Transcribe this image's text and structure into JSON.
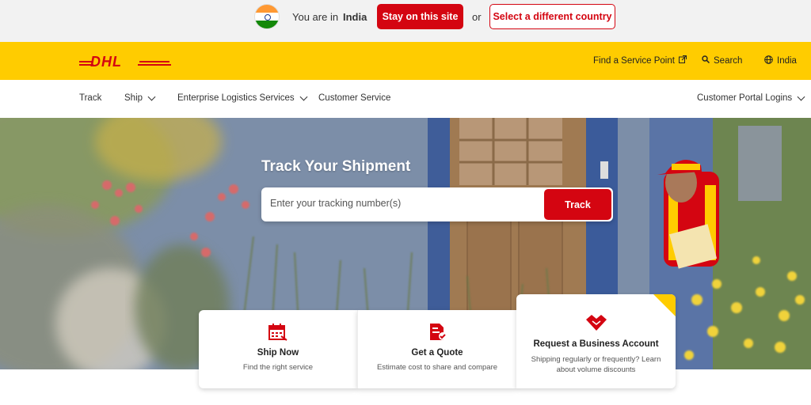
{
  "country_bar": {
    "you_are_in": "You are in",
    "country": "India",
    "stay_button": "Stay on this site",
    "or": "or",
    "different_country_button": "Select a different country"
  },
  "header": {
    "logo_text": "DHL",
    "service_point": "Find a Service Point",
    "search": "Search",
    "region": "India"
  },
  "nav": {
    "items": [
      {
        "label": "Track"
      },
      {
        "label": "Ship"
      },
      {
        "label": "Enterprise Logistics Services"
      },
      {
        "label": "Customer Service"
      }
    ],
    "portal": "Customer Portal Logins"
  },
  "hero": {
    "title": "Track Your Shipment",
    "input_placeholder": "Enter your tracking number(s)",
    "track_button": "Track"
  },
  "cards": [
    {
      "title": "Ship Now",
      "subtitle": "Find the right service",
      "icon": "calendar-icon"
    },
    {
      "title": "Get a Quote",
      "subtitle": "Estimate cost to share and compare",
      "icon": "quote-document-icon"
    },
    {
      "title": "Request a Business Account",
      "subtitle": "Shipping regularly or frequently? Learn about volume discounts",
      "icon": "handshake-icon"
    }
  ],
  "colors": {
    "brand_yellow": "#ffcc00",
    "brand_red": "#d40511"
  }
}
